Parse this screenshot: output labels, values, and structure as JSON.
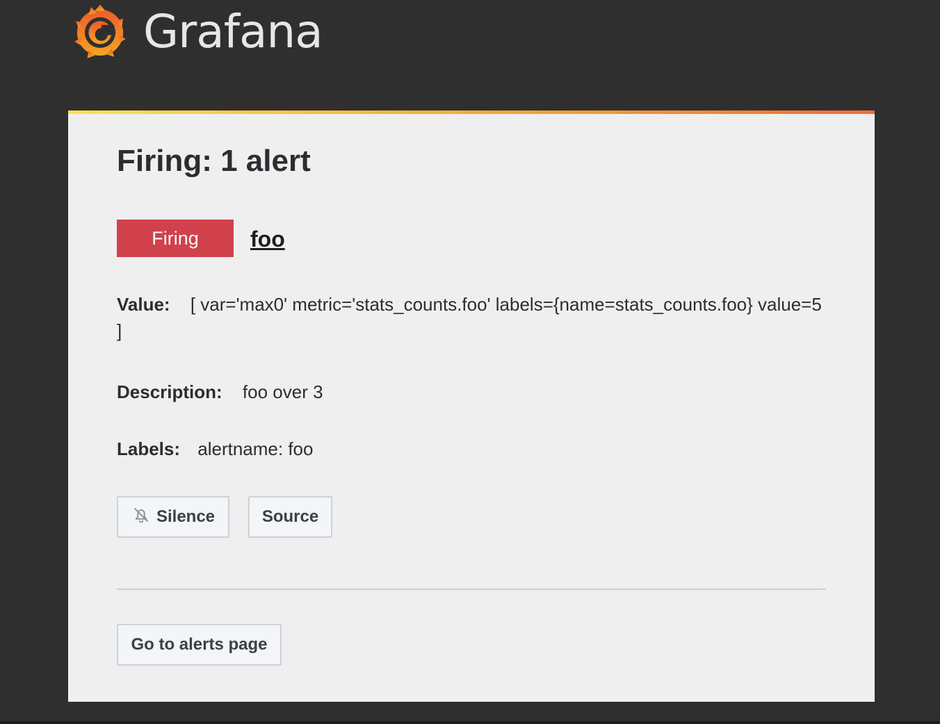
{
  "brand": {
    "name": "Grafana",
    "logo_icon": "grafana-swirl-icon",
    "accent_colors": [
      "#f9e44d",
      "#f4b03e",
      "#ec6f35"
    ]
  },
  "alert": {
    "title": "Firing: 1 alert",
    "status_badge": "Firing",
    "status_color": "#d1414b",
    "name": "foo",
    "value_label": "Value:",
    "value": "[ var='max0' metric='stats_counts.foo' labels={name=stats_counts.foo} value=5 ]",
    "description_label": "Description:",
    "description": "foo over 3",
    "labels_label": "Labels:",
    "labels": "alertname: foo"
  },
  "actions": {
    "silence_label": "Silence",
    "silence_icon": "bell-slash-icon",
    "source_label": "Source",
    "alerts_page_label": "Go to alerts page"
  }
}
